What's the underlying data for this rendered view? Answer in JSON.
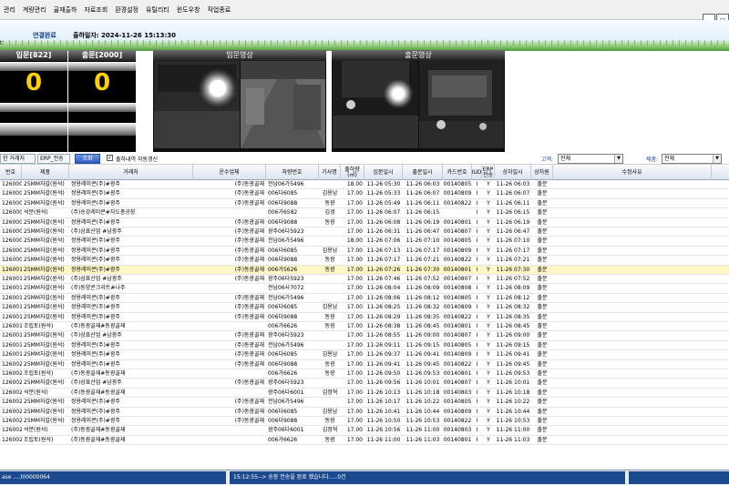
{
  "menu": [
    "관리",
    "계량관리",
    "골재출하",
    "자료조회",
    "환경설정",
    "유틸리티",
    "윈도우창",
    "작업종료"
  ],
  "header": {
    "connection_status": "연결완료",
    "shipping_date": "출하일자: 2024-11-26 15:13:30",
    "left_mark": "t"
  },
  "counters": {
    "inbound": {
      "title": "입문[822]",
      "value": "0"
    },
    "outbound": {
      "title": "출문[2000]",
      "value": "0"
    }
  },
  "cameras": {
    "inbound_title": "입문영상",
    "outbound_title": "출문영상"
  },
  "toolbar": {
    "tab_clients": "한 거래처",
    "tab_erp": "ERP_전송",
    "search_label": "조회",
    "auto_refresh_checked": "✓",
    "auto_refresh_label": "출하내역 자동갱신",
    "customer_label": "고객:",
    "customer_value": "전체",
    "product_label": "제품:",
    "product_value": "전체"
  },
  "grid": {
    "columns": [
      "번호",
      "제품",
      "거래처",
      "운수업체",
      "차량번호",
      "기사명",
      "출하량(㎥)",
      "입문일시",
      "출문일시",
      "카드번호",
      "IUD",
      "ERP전송",
      "상차일시",
      "상차원",
      "수정사유"
    ],
    "rows": [
      [
        "1260001",
        "25MM자갈(원석)",
        "쌍용레미콘(주)#광주",
        "(주)동광골재",
        "전남06가5496",
        "",
        "18.00",
        "11-26 05:30",
        "11-26 06:03",
        "00140805",
        "I",
        "Y",
        "11-26 06:03",
        "출문",
        ""
      ],
      [
        "1260002",
        "25MM자갈(원석)",
        "쌍용레미콘(주)#광주",
        "(주)동광골재",
        "006다6085",
        "김용남",
        "17.00",
        "11-26 05:33",
        "11-26 06:07",
        "00140809",
        "I",
        "Y",
        "11-26 06:07",
        "출문",
        ""
      ],
      [
        "1260003",
        "25MM자갈(원석)",
        "쌍용레미콘(주)#광주",
        "(주)동광골재",
        "006다9088",
        "동광",
        "17.00",
        "11-26 05:49",
        "11-26 06:11",
        "00140822",
        "I",
        "Y",
        "11-26 06:11",
        "출문",
        ""
      ],
      [
        "1260004",
        "석분(원석)",
        "(주)송강레미콘#자도충공장",
        "",
        "006가6582",
        "김경",
        "17.00",
        "11-26 06:07",
        "11-26 06:15",
        "",
        "I",
        "Y",
        "11-26 06:15",
        "출문",
        ""
      ],
      [
        "1260005",
        "25MM자갈(원석)",
        "쌍용레미콘(주)#광주",
        "(주)동광골재",
        "006다9088",
        "동광",
        "17.00",
        "11-26 06:08",
        "11-26 06:19",
        "00140801",
        "I",
        "Y",
        "11-26 06:19",
        "출문",
        ""
      ],
      [
        "1260006",
        "25MM자갈(원석)",
        "(주)삼표산업 #남광주",
        "(주)동광골재",
        "광주06다5923",
        "",
        "17.00",
        "11-26 06:31",
        "11-26 06:47",
        "00140807",
        "I",
        "Y",
        "11-26 06:47",
        "출문",
        ""
      ],
      [
        "1260007",
        "25MM자갈(원석)",
        "쌍용레미콘(주)#광주",
        "(주)동광골재",
        "전남06가5496",
        "",
        "18.00",
        "11-26 07:06",
        "11-26 07:10",
        "00140805",
        "I",
        "Y",
        "11-26 07:10",
        "출문",
        ""
      ],
      [
        "1260008",
        "25MM자갈(원석)",
        "쌍용레미콘(주)#광주",
        "(주)동광골재",
        "006다6085",
        "김용남",
        "17.00",
        "11-26 07:13",
        "11-26 07:17",
        "00140809",
        "I",
        "Y",
        "11-26 07:17",
        "출문",
        ""
      ],
      [
        "1260009",
        "25MM자갈(원석)",
        "쌍용레미콘(주)#광주",
        "(주)동광골재",
        "006다9088",
        "동광",
        "17.00",
        "11-26 07:17",
        "11-26 07:21",
        "00140822",
        "I",
        "Y",
        "11-26 07:21",
        "출문",
        ""
      ],
      [
        "1260010",
        "25MM자갈(원석)",
        "쌍용레미콘(주)#광주",
        "(주)동광골재",
        "006가5626",
        "동광",
        "17.00",
        "11-26 07:26",
        "11-26 07:30",
        "00140801",
        "I",
        "Y",
        "11-26 07:30",
        "출문",
        ""
      ],
      [
        "1260011",
        "25MM자갈(원석)",
        "(주)삼표산업 #남광주",
        "(주)동광골재",
        "광주06다5923",
        "",
        "17.00",
        "11-26 07:46",
        "11-26 07:52",
        "00140807",
        "I",
        "Y",
        "11-26 07:52",
        "출문",
        ""
      ],
      [
        "1260012",
        "25MM자갈(원석)",
        "(주)동양콘크리트#나주",
        "",
        "전남06사7072",
        "",
        "17.00",
        "11-26 08:04",
        "11-26 08:09",
        "00140808",
        "I",
        "Y",
        "11-26 08:09",
        "출문",
        ""
      ],
      [
        "1260013",
        "25MM자갈(원석)",
        "쌍용레미콘(주)#광주",
        "(주)동광골재",
        "전남06가5496",
        "",
        "17.00",
        "11-26 08:06",
        "11-26 08:12",
        "00140805",
        "I",
        "Y",
        "11-26 08:12",
        "출문",
        ""
      ],
      [
        "1260014",
        "25MM자갈(원석)",
        "쌍용레미콘(주)#광주",
        "(주)동광골재",
        "006다6085",
        "김용남",
        "17.00",
        "11-26 08:25",
        "11-26 08:32",
        "00140809",
        "I",
        "Y",
        "11-26 08:32",
        "출문",
        ""
      ],
      [
        "1260015",
        "25MM자갈(원석)",
        "쌍용레미콘(주)#광주",
        "(주)동광골재",
        "006다9088",
        "동광",
        "17.00",
        "11-26 08:29",
        "11-26 08:35",
        "00140822",
        "I",
        "Y",
        "11-26 08:35",
        "출문",
        ""
      ],
      [
        "1260016",
        "조립토(원석)",
        "(주)동광골재#동광골재",
        "",
        "006가6626",
        "동광",
        "17.00",
        "11-26 08:38",
        "11-26 08:45",
        "00140801",
        "I",
        "Y",
        "11-26 08:45",
        "출문",
        ""
      ],
      [
        "1260017",
        "25MM자갈(원석)",
        "(주)삼표산업 #남광주",
        "(주)동광골재",
        "광주06다5923",
        "",
        "17.00",
        "11-26 08:55",
        "11-26 09:00",
        "00140807",
        "I",
        "Y",
        "11-26 09:00",
        "출문",
        ""
      ],
      [
        "1260018",
        "25MM자갈(원석)",
        "쌍용레미콘(주)#광주",
        "(주)동광골재",
        "전남06가5496",
        "",
        "17.00",
        "11-26 09:11",
        "11-26 09:15",
        "00140805",
        "I",
        "Y",
        "11-26 09:15",
        "출문",
        ""
      ],
      [
        "1260019",
        "25MM자갈(원석)",
        "쌍용레미콘(주)#광주",
        "(주)동광골재",
        "006다6085",
        "김용남",
        "17.00",
        "11-26 09:37",
        "11-26 09:41",
        "00140809",
        "I",
        "Y",
        "11-26 09:41",
        "출문",
        ""
      ],
      [
        "1260020",
        "25MM자갈(원석)",
        "쌍용레미콘(주)#광주",
        "(주)동광골재",
        "006다9088",
        "동광",
        "17.00",
        "11-26 09:41",
        "11-26 09:45",
        "00140822",
        "I",
        "Y",
        "11-26 09:45",
        "출문",
        ""
      ],
      [
        "1260021",
        "조립토(원석)",
        "(주)동광골재#동광골재",
        "",
        "006가6626",
        "동광",
        "17.00",
        "11-26 09:50",
        "11-26 09:53",
        "00140801",
        "I",
        "Y",
        "11-26 09:53",
        "출문",
        ""
      ],
      [
        "1260022",
        "25MM자갈(원석)",
        "(주)삼표산업 #남광주",
        "(주)동광골재",
        "광주06다5923",
        "",
        "17.00",
        "11-26 09:56",
        "11-26 10:01",
        "00140807",
        "I",
        "Y",
        "11-26 10:01",
        "출문",
        ""
      ],
      [
        "1260023",
        "석분(원석)",
        "(주)동광골재#동광골재",
        "",
        "광주06다6001",
        "김정혁",
        "17.00",
        "11-26 10:13",
        "11-26 10:18",
        "00140803",
        "I",
        "Y",
        "11-26 10:18",
        "출문",
        ""
      ],
      [
        "1260024",
        "25MM자갈(원석)",
        "쌍용레미콘(주)#광주",
        "(주)동광골재",
        "전남06가5496",
        "",
        "17.00",
        "11-26 10:17",
        "11-26 10:22",
        "00140805",
        "I",
        "Y",
        "11-26 10:22",
        "출문",
        ""
      ],
      [
        "1260025",
        "25MM자갈(원석)",
        "쌍용레미콘(주)#광주",
        "(주)동광골재",
        "006다6085",
        "김용남",
        "17.00",
        "11-26 10:41",
        "11-26 10:44",
        "00140809",
        "I",
        "Y",
        "11-26 10:44",
        "출문",
        ""
      ],
      [
        "1260026",
        "25MM자갈(원석)",
        "쌍용레미콘(주)#광주",
        "(주)동광골재",
        "006다9088",
        "동광",
        "17.00",
        "11-26 10:50",
        "11-26 10:53",
        "00140822",
        "I",
        "Y",
        "11-26 10:53",
        "출문",
        ""
      ],
      [
        "1260027",
        "석분(원석)",
        "(주)동광골재#동광골재",
        "",
        "광주06다6001",
        "김정혁",
        "17.00",
        "11-26 10:56",
        "11-26 11:00",
        "00140803",
        "I",
        "Y",
        "11-26 11:00",
        "출문",
        ""
      ],
      [
        "1260028",
        "조립토(원석)",
        "(주)동광골재#동광골재",
        "",
        "006가6626",
        "동광",
        "17.00",
        "11-26 11:00",
        "11-26 11:03",
        "00140801",
        "I",
        "Y",
        "11-26 11:03",
        "출문",
        ""
      ]
    ],
    "selected_row": 9
  },
  "statusbar": {
    "left": "ase ....)00000064",
    "message": "15:12:55--> 송장 전송을 완료 했습니다.....0건"
  },
  "colors": {
    "selected_row": "#fff7c6",
    "counter_value": "#ffd000",
    "status_blue": "#1c4a8e"
  }
}
